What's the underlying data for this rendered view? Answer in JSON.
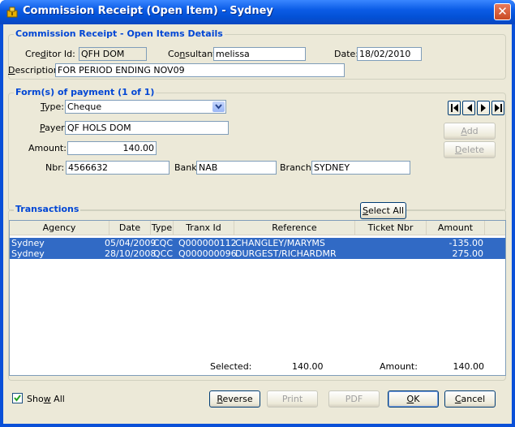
{
  "window": {
    "title": "Commission Receipt (Open Item) - Sydney"
  },
  "details": {
    "group_title": "Commission Receipt - Open Items Details",
    "creditor_label": "Creditor Id:",
    "creditor_value": "QFH DOM",
    "consultant_label": "Consultant:",
    "consultant_value": "melissa",
    "date_label": "Date:",
    "date_value": "18/02/2010",
    "description_label": "Description:",
    "description_value": "FOR PERIOD ENDING NOV09"
  },
  "payment": {
    "group_title": "Form(s) of payment (1 of 1)",
    "type_label": "Type:",
    "type_value": "Cheque",
    "payer_label": "Payer :",
    "payer_value": "QF HOLS DOM",
    "amount_label": "Amount:",
    "amount_value": "140.00",
    "nbr_label": "Nbr:",
    "nbr_value": "4566632",
    "bank_label": "Bank:",
    "bank_value": "NAB",
    "branch_label": "Branch:",
    "branch_value": "SYDNEY",
    "add_label": "Add",
    "delete_label": "Delete"
  },
  "transactions": {
    "group_title": "Transactions",
    "select_all_label": "Select All",
    "columns": [
      "Agency",
      "Date",
      "Type",
      "Tranx Id",
      "Reference",
      "Ticket Nbr",
      "Amount"
    ],
    "rows": [
      {
        "agency": "Sydney",
        "date": "05/04/2009",
        "type": "CQC",
        "tranx_id": "Q000000112",
        "reference": "CHANGLEY/MARYMS",
        "ticket": "",
        "amount": "-135.00"
      },
      {
        "agency": "Sydney",
        "date": "28/10/2008",
        "type": "QCC",
        "tranx_id": "Q000000096",
        "reference": "DURGEST/RICHARDMR",
        "ticket": "",
        "amount": "275.00"
      }
    ],
    "selected_label": "Selected:",
    "selected_value": "140.00",
    "amount_label": "Amount:",
    "amount_value": "140.00"
  },
  "footer": {
    "show_all_label": "Show All",
    "show_all_checked": true,
    "reverse_label": "Reverse",
    "print_label": "Print",
    "pdf_label": "PDF",
    "ok_label": "OK",
    "cancel_label": "Cancel"
  },
  "colors": {
    "accent": "#0046d5",
    "selection": "#316ac5",
    "titlebar": "#0351d6"
  }
}
